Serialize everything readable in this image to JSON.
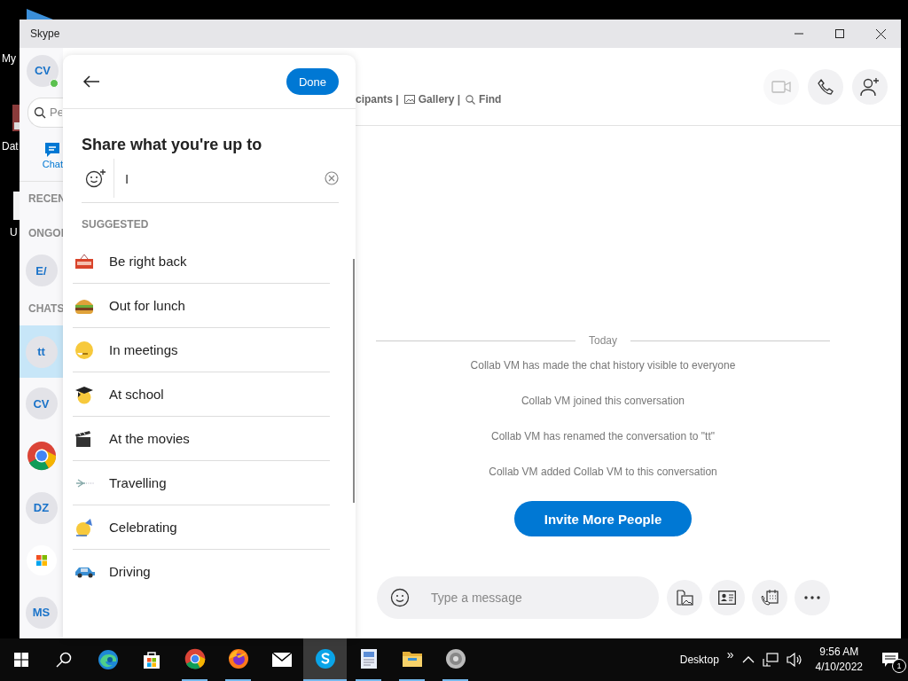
{
  "desktop": {
    "icons": [
      {
        "label": "My"
      },
      {
        "label": "Dat"
      },
      {
        "label": "U"
      }
    ]
  },
  "window": {
    "title": "Skype"
  },
  "sidebar": {
    "profile": {
      "initials": "CV",
      "online": true
    },
    "search": {
      "placeholder": "Pe"
    },
    "nav": [
      {
        "label": "Chat",
        "selected": true
      }
    ],
    "items": [
      {
        "kind": "header",
        "label": "RECEN"
      },
      {
        "kind": "header",
        "label": "ONGOI"
      },
      {
        "kind": "avatar",
        "initials": "E/",
        "selected": false
      },
      {
        "kind": "header",
        "label": "CHATS"
      },
      {
        "kind": "avatar",
        "initials": "tt",
        "selected": true
      },
      {
        "kind": "avatar",
        "initials": "CV",
        "selected": false
      },
      {
        "kind": "browser-logo",
        "selected": false
      },
      {
        "kind": "avatar",
        "initials": "DZ",
        "selected": false
      },
      {
        "kind": "tiles-logo",
        "selected": false
      },
      {
        "kind": "avatar",
        "initials": "MS",
        "selected": false
      }
    ]
  },
  "status_panel": {
    "done_button": "Done",
    "title": "Share what you're up to",
    "input": {
      "value": "I"
    },
    "section_label": "SUGGESTED",
    "suggestions": [
      {
        "kind": "brb",
        "label": "Be right back"
      },
      {
        "kind": "burger",
        "label": "Out for lunch"
      },
      {
        "kind": "meeting",
        "label": "In meetings"
      },
      {
        "kind": "school",
        "label": "At school"
      },
      {
        "kind": "movies",
        "label": "At the movies"
      },
      {
        "kind": "plane",
        "label": "Travelling"
      },
      {
        "kind": "party",
        "label": "Celebrating"
      },
      {
        "kind": "car",
        "label": "Driving"
      }
    ]
  },
  "chat": {
    "links": [
      {
        "kind": "participants",
        "label": "cipants |"
      },
      {
        "kind": "gallery",
        "label": "Gallery |"
      },
      {
        "kind": "find",
        "label": "Find"
      }
    ],
    "call_buttons": [
      {
        "kind": "video",
        "disabled": true
      },
      {
        "kind": "call",
        "disabled": false
      },
      {
        "kind": "add-person",
        "disabled": false
      }
    ],
    "date": "Today",
    "events": [
      "Collab VM has made the chat history visible to everyone",
      "Collab VM joined this conversation",
      "Collab VM has renamed the conversation to \"tt\"",
      "Collab VM added Collab VM to this conversation"
    ],
    "invite_button": "Invite More People",
    "composer": {
      "placeholder": "Type a message",
      "tools": [
        {
          "kind": "media"
        },
        {
          "kind": "contact"
        },
        {
          "kind": "schedule-call"
        },
        {
          "kind": "more"
        }
      ]
    }
  },
  "taskbar": {
    "apps": [
      {
        "kind": "edge",
        "selected": false,
        "running": false
      },
      {
        "kind": "store",
        "selected": false,
        "running": false
      },
      {
        "kind": "chrome",
        "selected": false,
        "running": true
      },
      {
        "kind": "firefox",
        "selected": false,
        "running": true
      },
      {
        "kind": "mail",
        "selected": false,
        "running": false
      },
      {
        "kind": "skype",
        "selected": true,
        "running": true
      },
      {
        "kind": "document",
        "selected": false,
        "running": true
      },
      {
        "kind": "folder",
        "selected": false,
        "running": true
      },
      {
        "kind": "speaker",
        "selected": false,
        "running": true
      }
    ],
    "desktop_label": "Desktop",
    "overflow": "»",
    "time": "9:56 AM",
    "date": "4/10/2022",
    "notifications": "1"
  }
}
